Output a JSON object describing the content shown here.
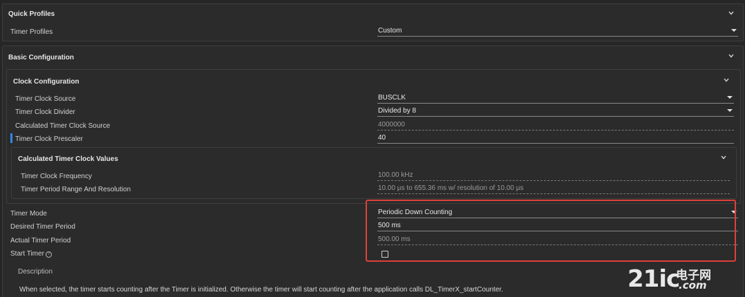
{
  "quick_profiles": {
    "title": "Quick Profiles",
    "timer_profiles_label": "Timer Profiles",
    "timer_profiles_value": "Custom"
  },
  "basic_configuration": {
    "title": "Basic Configuration"
  },
  "clock_configuration": {
    "title": "Clock Configuration",
    "clock_source_label": "Timer Clock Source",
    "clock_source_value": "BUSCLK",
    "clock_divider_label": "Timer Clock Divider",
    "clock_divider_value": "Divided by 8",
    "calc_clock_source_label": "Calculated Timer Clock Source",
    "calc_clock_source_value": "4000000",
    "prescaler_label": "Timer Clock Prescaler",
    "prescaler_value": "40"
  },
  "calculated_values": {
    "title": "Calculated Timer Clock Values",
    "frequency_label": "Timer Clock Frequency",
    "frequency_value": "100.00 kHz",
    "period_range_label": "Timer Period Range And Resolution",
    "period_range_value": "10.00 µs to 655.36 ms w/ resolution of 10.00 µs"
  },
  "timer": {
    "mode_label": "Timer Mode",
    "mode_value": "Periodic Down Counting",
    "desired_period_label": "Desired Timer Period",
    "desired_period_value": "500 ms",
    "actual_period_label": "Actual Timer Period",
    "actual_period_value": "500.00 ms",
    "start_timer_label": "Start Timer",
    "help_glyph": "?"
  },
  "description": {
    "title": "Description",
    "text": "When selected, the timer starts counting after the Timer is initialized. Otherwise the timer will start counting after the application calls DL_TimerX_startCounter."
  },
  "watermark": {
    "brand": "21ic",
    "cn": "电子网",
    "domain": ".com"
  },
  "colors": {
    "background": "#262626",
    "highlight": "#e0403a",
    "accent": "#2f8be6"
  }
}
